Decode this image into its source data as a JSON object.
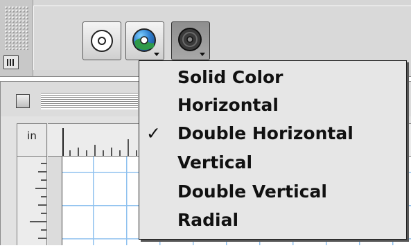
{
  "toolbar": {
    "buttons": [
      {
        "name": "solid-fill",
        "icon": "solid-circle-icon"
      },
      {
        "name": "gradient-fill",
        "icon": "gradient-globe-icon"
      },
      {
        "name": "texture-fill",
        "icon": "dark-circle-icon"
      }
    ]
  },
  "document": {
    "ruler_unit": "in"
  },
  "menu": {
    "check_mark": "✓",
    "items": [
      {
        "label": "Solid Color",
        "checked": false
      },
      {
        "label": "Horizontal",
        "checked": false
      },
      {
        "label": "Double Horizontal",
        "checked": true
      },
      {
        "label": "Vertical",
        "checked": false
      },
      {
        "label": "Double Vertical",
        "checked": false
      },
      {
        "label": "Radial",
        "checked": false
      }
    ]
  },
  "colors": {
    "grid": "#8fc1ef",
    "panel": "#d6d6d6",
    "menu_bg": "#e6e6e6"
  }
}
